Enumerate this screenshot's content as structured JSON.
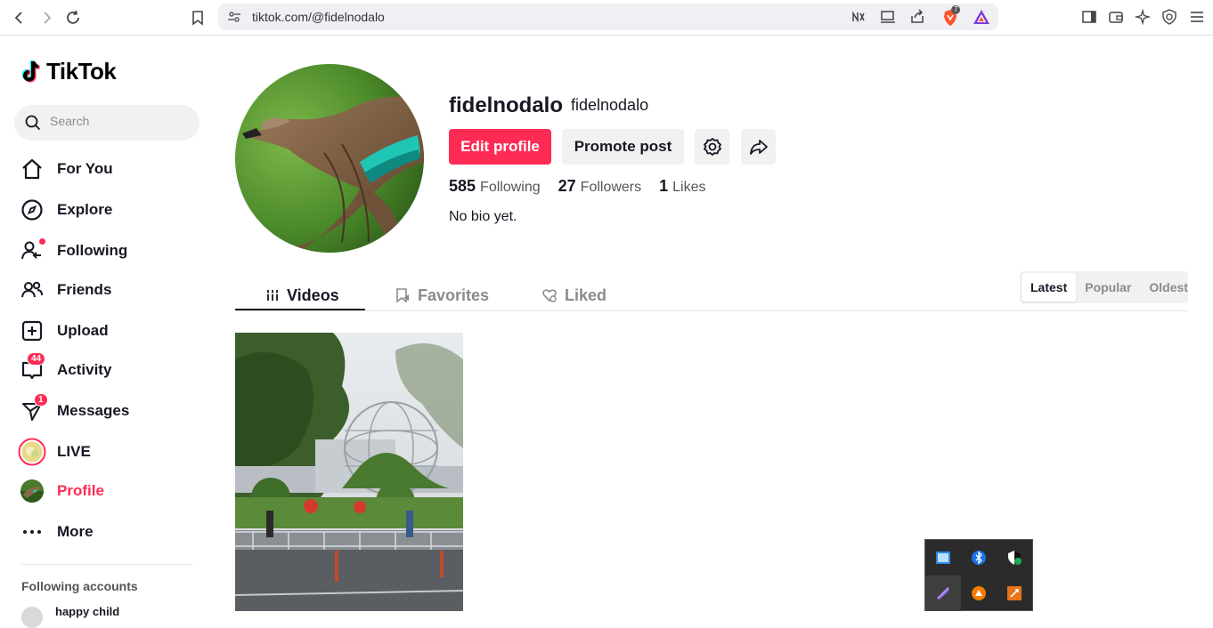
{
  "browser": {
    "url": "tiktok.com/@fidelnodalo",
    "brave_badge": "7"
  },
  "sidebar": {
    "logo_text": "TikTok",
    "search_placeholder": "Search",
    "items": [
      {
        "label": "For You",
        "icon": "home-icon"
      },
      {
        "label": "Explore",
        "icon": "compass-icon"
      },
      {
        "label": "Following",
        "icon": "following-icon"
      },
      {
        "label": "Friends",
        "icon": "friends-icon"
      },
      {
        "label": "Upload",
        "icon": "plus-square-icon"
      },
      {
        "label": "Activity",
        "icon": "activity-icon",
        "badge": "44"
      },
      {
        "label": "Messages",
        "icon": "send-icon",
        "badge": "1"
      },
      {
        "label": "LIVE",
        "icon": "live-avatar-icon"
      },
      {
        "label": "Profile",
        "icon": "profile-avatar-icon",
        "active": true
      },
      {
        "label": "More",
        "icon": "more-dots-icon"
      }
    ],
    "following_accounts_title": "Following accounts",
    "following_accounts": [
      {
        "name": "happy child"
      }
    ]
  },
  "profile": {
    "username": "fidelnodalo",
    "nickname": "fidelnodalo",
    "edit_label": "Edit profile",
    "promote_label": "Promote post",
    "stats": {
      "following_count": "585",
      "following_label": "Following",
      "followers_count": "27",
      "followers_label": "Followers",
      "likes_count": "1",
      "likes_label": "Likes"
    },
    "bio": "No bio yet."
  },
  "tabs": [
    {
      "label": "Videos",
      "active": true
    },
    {
      "label": "Favorites"
    },
    {
      "label": "Liked"
    }
  ],
  "sort_options": [
    {
      "label": "Latest",
      "selected": true
    },
    {
      "label": "Popular"
    },
    {
      "label": "Oldest"
    }
  ],
  "colors": {
    "accent": "#fe2c55",
    "text": "#161823"
  }
}
